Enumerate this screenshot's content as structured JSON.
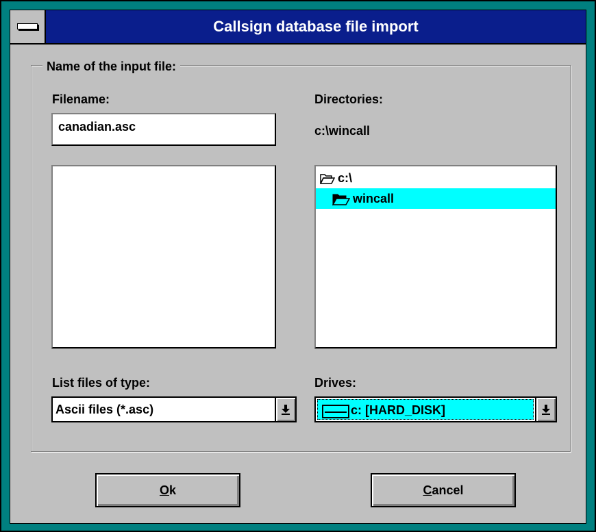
{
  "window": {
    "title": "Callsign database file import"
  },
  "group": {
    "label": "Name of the input file:"
  },
  "filename": {
    "label": "Filename:",
    "value": "canadian.asc"
  },
  "directories": {
    "label": "Directories:",
    "current": "c:\\wincall",
    "items": [
      {
        "label": "c:\\",
        "icon": "open-folder-icon"
      },
      {
        "label": "wincall",
        "icon": "open-folder-icon",
        "selected": true
      }
    ]
  },
  "filetype": {
    "label": "List files of type:",
    "value": "Ascii files  (*.asc)"
  },
  "drives": {
    "label": "Drives:",
    "value": "c: [HARD_DISK]"
  },
  "buttons": {
    "ok": {
      "mnemonic": "O",
      "rest": "k"
    },
    "cancel": {
      "mnemonic": "C",
      "rest": "ancel"
    }
  },
  "colors": {
    "title_bar": "#0a1e8c",
    "frame": "#008080",
    "selection": "#00ffff",
    "face": "#c0c0c0"
  }
}
